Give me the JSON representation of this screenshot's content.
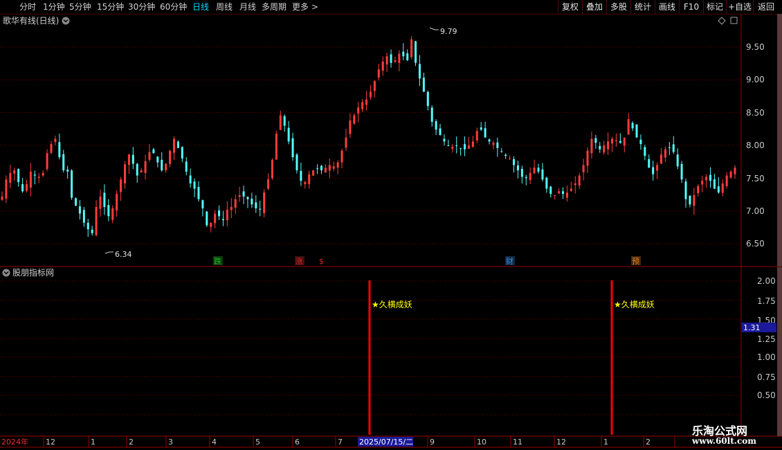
{
  "toolbar": {
    "left": [
      {
        "label": "分时",
        "active": false
      },
      {
        "label": "1分钟",
        "active": false
      },
      {
        "label": "5分钟",
        "active": false
      },
      {
        "label": "15分钟",
        "active": false
      },
      {
        "label": "30分钟",
        "active": false
      },
      {
        "label": "60分钟",
        "active": false
      },
      {
        "label": "日线",
        "active": true
      },
      {
        "label": "周线",
        "active": false
      },
      {
        "label": "月线",
        "active": false
      },
      {
        "label": "多周期",
        "active": false
      },
      {
        "label": "更多",
        "active": false
      }
    ],
    "right": [
      "复权",
      "叠加",
      "多股",
      "统计",
      "画线",
      "F10",
      "标记",
      "+自选",
      "返回"
    ]
  },
  "main_panel": {
    "title": "歌华有线(日线)",
    "price_labels": [
      "9.50",
      "9.00",
      "8.50",
      "8.00",
      "7.50",
      "7.00",
      "6.50"
    ],
    "high_label": "9.79",
    "low_label": "6.34",
    "markers": [
      {
        "text": "跌",
        "color": "#18c018"
      },
      {
        "text": "涨",
        "color": "#e02020"
      },
      {
        "text": "$",
        "color": "#e02020"
      },
      {
        "text": "财",
        "color": "#3a8ad8"
      },
      {
        "text": "预",
        "color": "#e08020"
      }
    ]
  },
  "sub_panel": {
    "title": "股朋指标网",
    "axis_labels": [
      "2.00",
      "1.75",
      "1.50",
      "1.25",
      "1.00",
      "0.75",
      "0.50"
    ],
    "current_value": "1.31",
    "signals": [
      "★久横成妖",
      "★久横成妖"
    ]
  },
  "date_axis": {
    "labels": [
      "2024年",
      "12",
      "1",
      "2",
      "3",
      "4",
      "5",
      "6",
      "7",
      "2025/07/15/二",
      "9",
      "10",
      "11",
      "12",
      "1",
      "2"
    ]
  },
  "watermark": {
    "line1": "乐淘公式网",
    "line2": "www.60lt.com"
  },
  "colors": {
    "up": "#ff3c3c",
    "down": "#54ffff",
    "grid": "#7a0000",
    "signal": "#ff0000",
    "signal_text": "#ffff00",
    "axis_text": "#c8c8c8"
  },
  "chart_data": {
    "type": "candlestick",
    "title": "歌华有线(日线)",
    "y_range": [
      6.2,
      9.85
    ],
    "x_axis": [
      "2024年",
      "12",
      "1",
      "2",
      "3",
      "4",
      "5",
      "6",
      "7",
      "2025/07/15/二",
      "9",
      "10",
      "11",
      "12",
      "1",
      "2"
    ],
    "series": [
      {
        "values": [
          7.22,
          7.48,
          7.58,
          7.62,
          7.44,
          7.3,
          7.41,
          7.6,
          7.54,
          7.52,
          7.58,
          7.88,
          8.02,
          8.1,
          7.82,
          7.62,
          7.6,
          7.2,
          7.08,
          6.96,
          6.82,
          6.72,
          6.66,
          7.06,
          7.22,
          7.06,
          6.92,
          7.04,
          7.26,
          7.48,
          7.71,
          7.86,
          7.72,
          7.54,
          7.62,
          7.76,
          7.9,
          7.88,
          7.74,
          7.62,
          7.72,
          7.92,
          8.1,
          7.96,
          7.8,
          7.6,
          7.42,
          7.34,
          7.18,
          7.04,
          6.78,
          6.82,
          6.96,
          6.92,
          6.86,
          7.02,
          7.06,
          7.18,
          7.24,
          7.22,
          7.18,
          7.1,
          7.04,
          7.02,
          7.28,
          7.48,
          7.78,
          8.18,
          8.46,
          8.3,
          8.06,
          7.82,
          7.62,
          7.46,
          7.44,
          7.56,
          7.62,
          7.64,
          7.62,
          7.66,
          7.7,
          7.68,
          7.74,
          7.92,
          8.12,
          8.38,
          8.46,
          8.58,
          8.66,
          8.7,
          8.82,
          8.98,
          9.16,
          9.28,
          9.36,
          9.26,
          9.3,
          9.4,
          9.36,
          9.3,
          9.62,
          9.26,
          9.02,
          8.82,
          8.6,
          8.36,
          8.24,
          8.16,
          8.06,
          8.0,
          7.98,
          8.0,
          7.96,
          7.94,
          8.0,
          8.06,
          8.22,
          8.24,
          8.12,
          8.06,
          8.04,
          7.96,
          7.9,
          7.84,
          7.8,
          7.7,
          7.62,
          7.52,
          7.5,
          7.58,
          7.66,
          7.6,
          7.48,
          7.34,
          7.26,
          7.24,
          7.3,
          7.26,
          7.28,
          7.34,
          7.42,
          7.54,
          7.7,
          7.92,
          8.1,
          8.04,
          7.94,
          8.0,
          8.06,
          8.1,
          8.08,
          8.04,
          8.12,
          8.4,
          8.26,
          8.12,
          8.02,
          7.84,
          7.66,
          7.56,
          7.7,
          7.86,
          7.94,
          7.96,
          7.9,
          7.68,
          7.48,
          7.18,
          7.1,
          7.24,
          7.38,
          7.46,
          7.52,
          7.46,
          7.34,
          7.28,
          7.42,
          7.54,
          7.6,
          7.66
        ]
      }
    ],
    "sub_series": {
      "name": "股朋指标网",
      "y_range": [
        0.35,
        2.05
      ],
      "current": 1.31,
      "signals": [
        {
          "date": "2025/07/15",
          "value": 2.0,
          "label": "★久横成妖"
        },
        {
          "date": "",
          "value": 2.0,
          "label": "★久横成妖"
        }
      ]
    }
  }
}
